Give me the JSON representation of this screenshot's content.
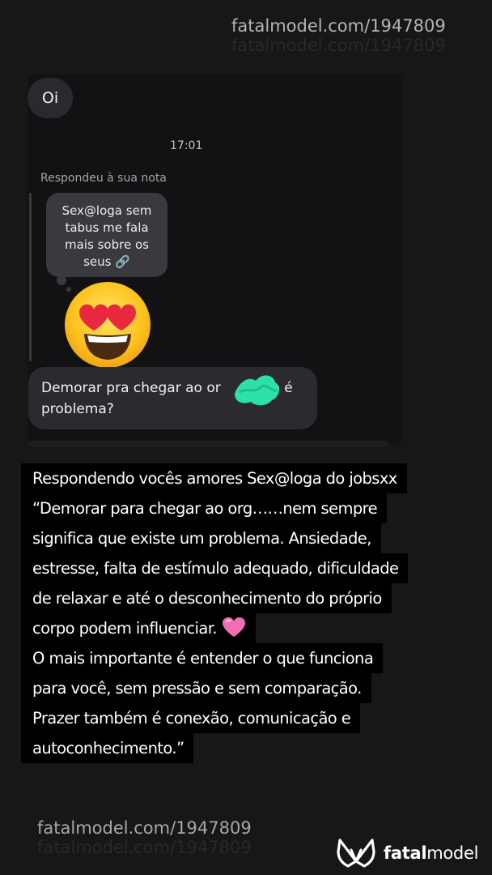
{
  "watermark": {
    "top": "fatalmodel.com/1947809",
    "bottom": "fatalmodel.com/1947809"
  },
  "chat": {
    "greeting": "Oi",
    "timestamp": "17:01",
    "replied_label": "Respondeu à sua nota",
    "note_text": "Sex@loga sem tabus me fala mais sobre os seus 🔗",
    "reaction_icon": "heart-eyes-emoji",
    "message_part1": "Demorar pra chegar ao or",
    "message_part2": "no é problema?"
  },
  "caption": {
    "lines": [
      "Respondendo vocês amores Sex@loga do jobsxx",
      "“Demorar para chegar ao org……nem sempre",
      "significa que existe um problema. Ansiedade,",
      "estresse, falta de estímulo adequado, dificuldade",
      "de relaxar e até o desconhecimento do próprio",
      "corpo podem influenciar.",
      "O mais importante é entender o que funciona",
      "para você, sem pressão e sem comparação.",
      "Prazer também é conexão, comunicação e",
      "autoconhecimento.”"
    ]
  },
  "brand": {
    "name_bold": "fatal",
    "name_regular": "model",
    "accent": "#2de0a7",
    "heart_color": "#f06fb0"
  }
}
